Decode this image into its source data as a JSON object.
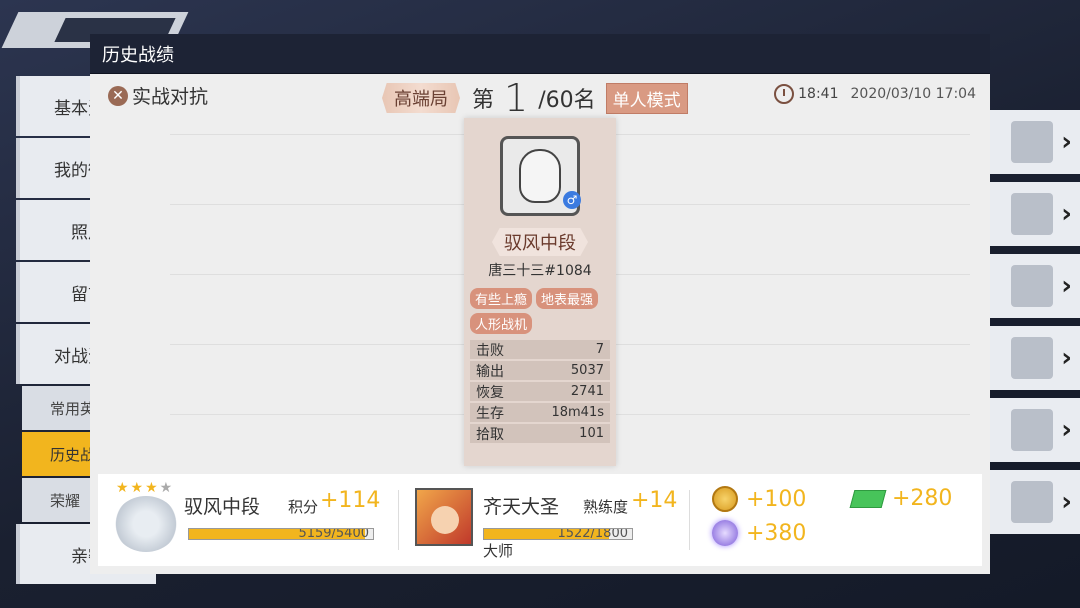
{
  "background": {
    "sidebar": {
      "items": [
        "基本资料",
        "我的徽章",
        "照片",
        "留言",
        "对战资料"
      ],
      "subitems": [
        "常用英雄",
        "历史战绩",
        "荣耀"
      ],
      "active_sub": "历史战绩",
      "last_item": "亲密"
    }
  },
  "modal": {
    "title": "历史战绩",
    "mode_label": "实战对抗",
    "tier_tag": "高端局",
    "rank_prefix": "第",
    "rank_number": "1",
    "rank_total": "/60名",
    "solo_mode": "单人模式",
    "duration": "18:41",
    "datetime": "2020/03/10 17:04"
  },
  "player": {
    "rank_name": "驭风中段",
    "name": "唐三十三#1084",
    "titles": [
      "有些上瘾",
      "地表最强",
      "人形战机"
    ],
    "stats": [
      {
        "label": "击败",
        "value": "7"
      },
      {
        "label": "输出",
        "value": "5037"
      },
      {
        "label": "恢复",
        "value": "2741"
      },
      {
        "label": "生存",
        "value": "18m41s"
      },
      {
        "label": "拾取",
        "value": "101"
      }
    ]
  },
  "summary": {
    "rank_name": "驭风中段",
    "score_label": "积分",
    "score_gain": "+114",
    "score_progress": "5159/5400",
    "score_fraction": 0.955,
    "hero_name": "齐天大圣",
    "proficiency_label": "熟练度",
    "proficiency_gain": "+14",
    "proficiency_progress": "1522/1800",
    "proficiency_fraction": 0.846,
    "hero_title": "大师",
    "rewards": {
      "coins": "+100",
      "ticket": "+280",
      "gems": "+380"
    },
    "stars_filled": 3
  }
}
